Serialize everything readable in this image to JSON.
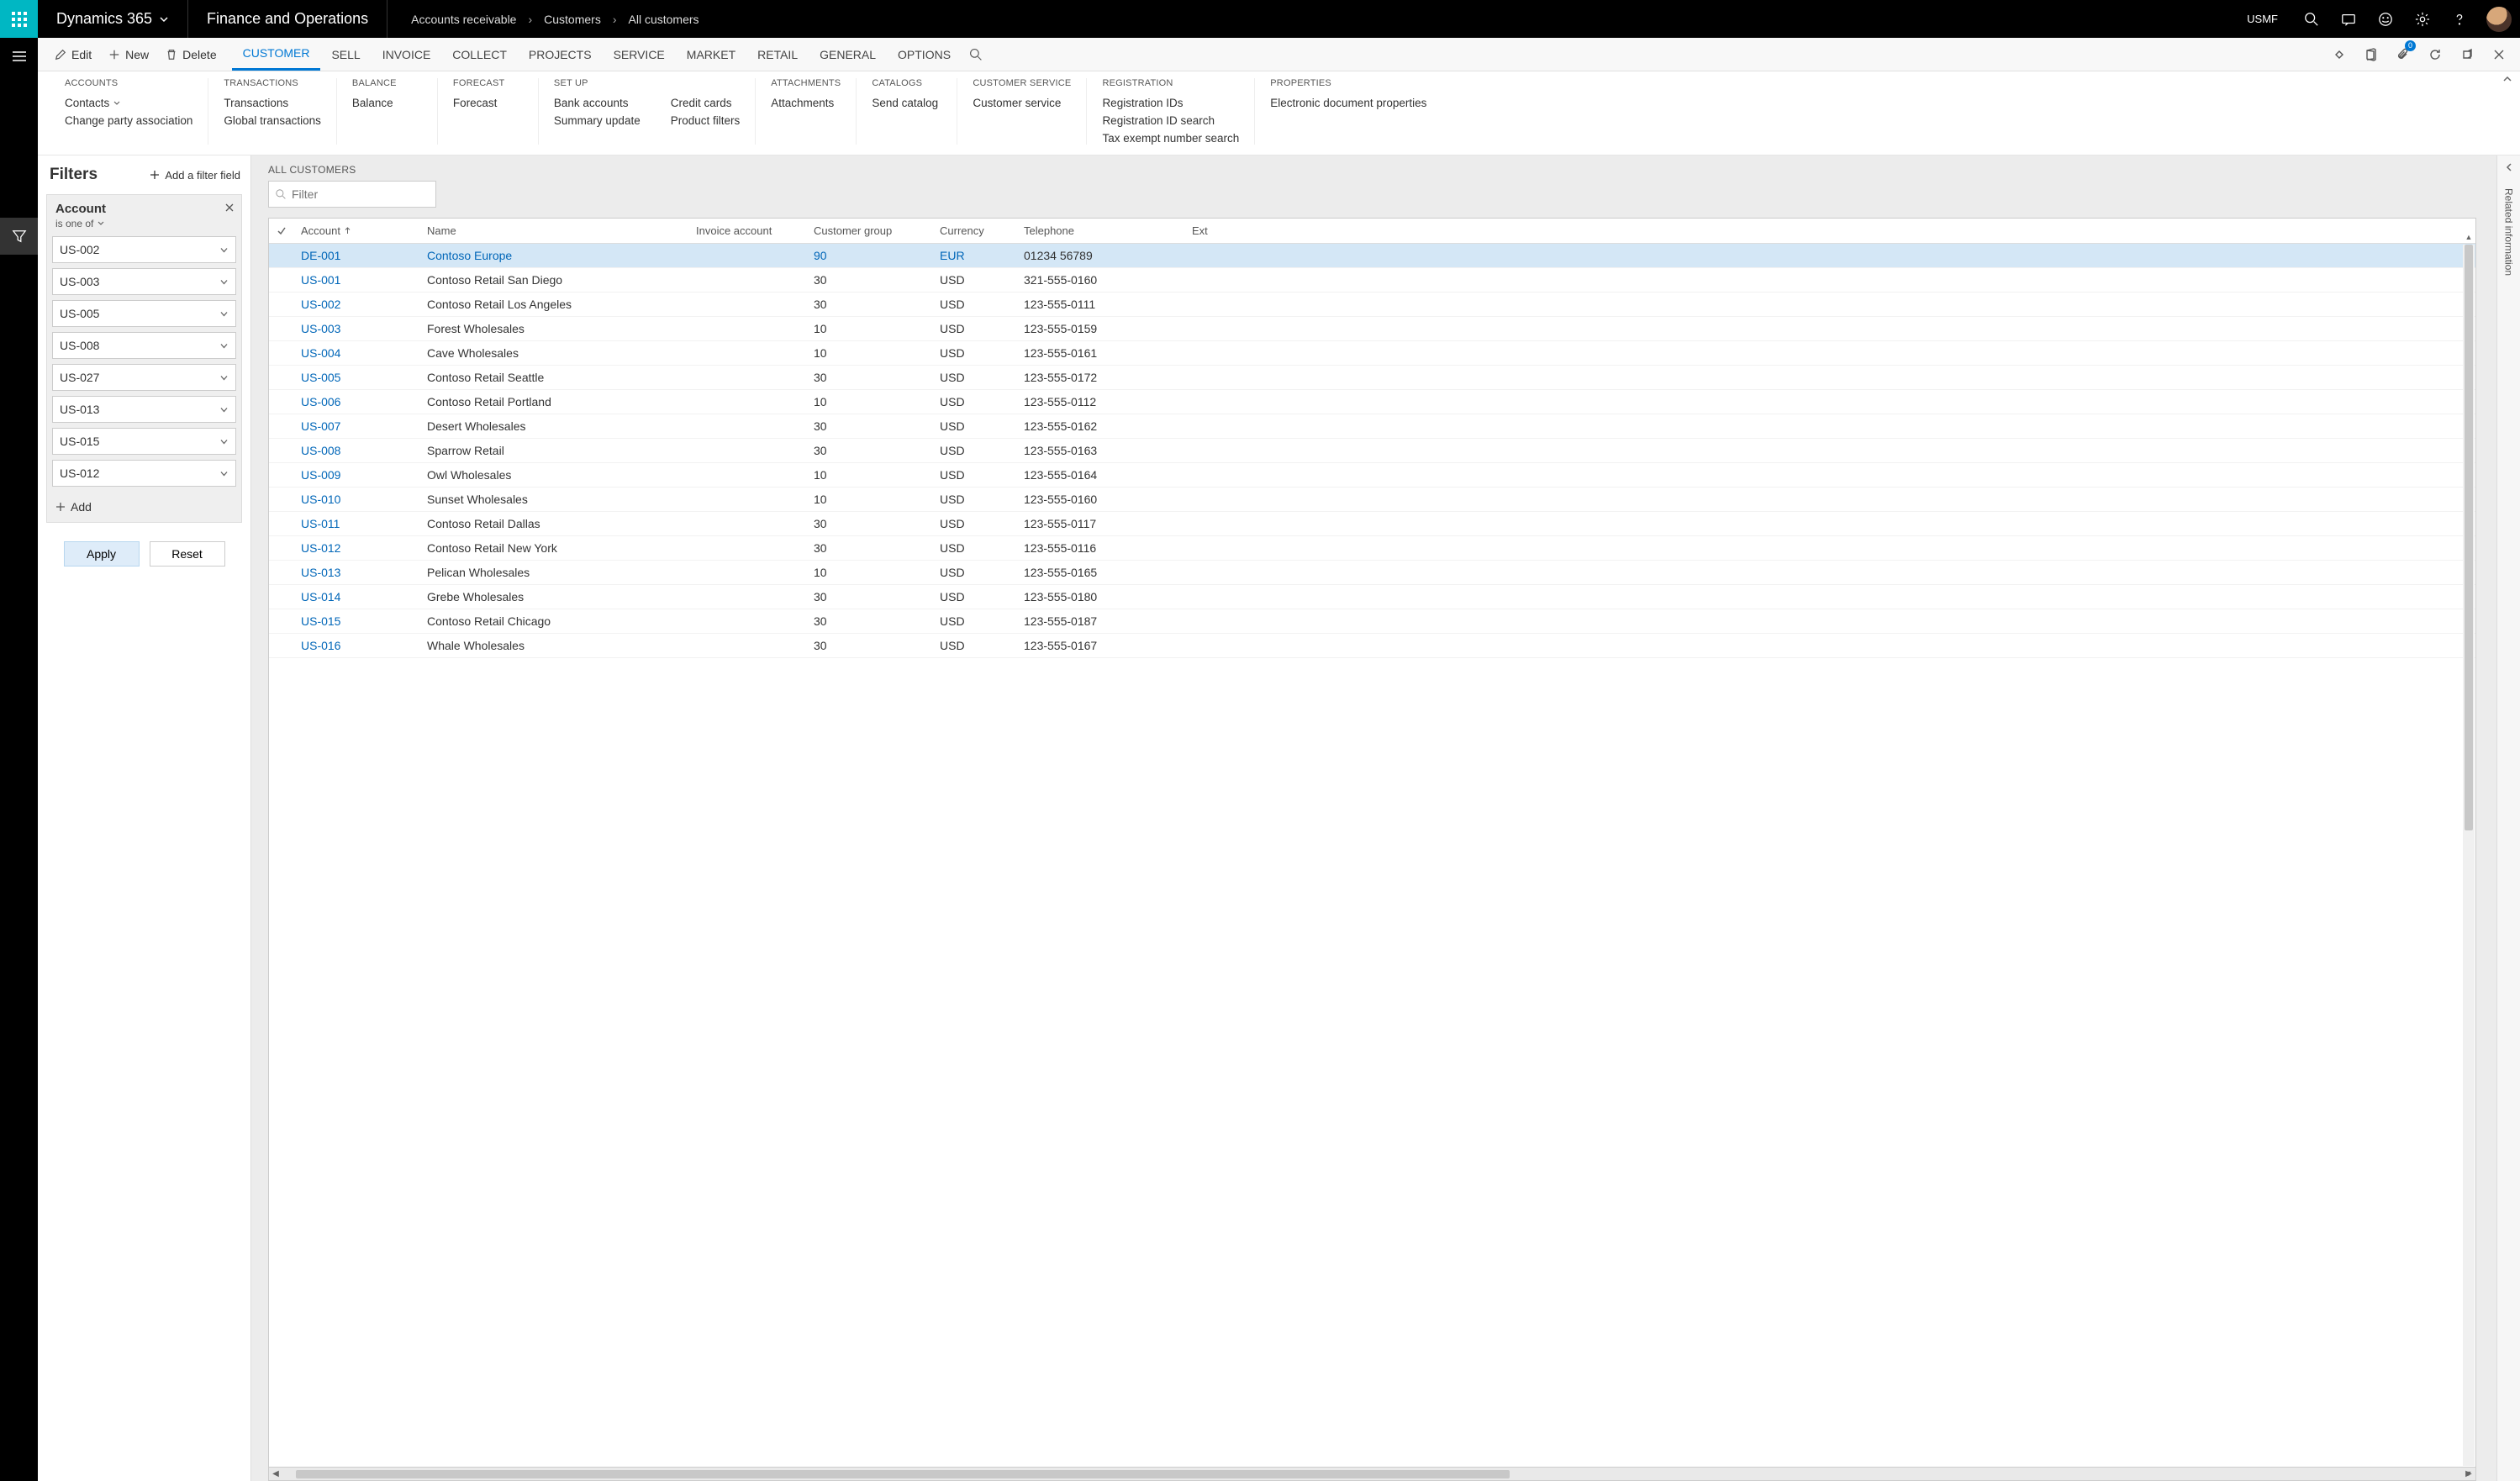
{
  "top": {
    "brand": "Dynamics 365",
    "title": "Finance and Operations",
    "breadcrumb": [
      "Accounts receivable",
      "Customers",
      "All customers"
    ],
    "entity": "USMF"
  },
  "commands": {
    "edit": "Edit",
    "new": "New",
    "delete": "Delete",
    "tabs": [
      "CUSTOMER",
      "SELL",
      "INVOICE",
      "COLLECT",
      "PROJECTS",
      "SERVICE",
      "MARKET",
      "RETAIL",
      "GENERAL",
      "OPTIONS"
    ],
    "active_tab_index": 0,
    "attach_badge": "0"
  },
  "ribbon": [
    {
      "header": "ACCOUNTS",
      "cols": [
        [
          "Contacts ▾",
          "Change party association"
        ]
      ]
    },
    {
      "header": "TRANSACTIONS",
      "cols": [
        [
          "Transactions",
          "Global transactions"
        ]
      ]
    },
    {
      "header": "BALANCE",
      "cols": [
        [
          "Balance"
        ]
      ]
    },
    {
      "header": "FORECAST",
      "cols": [
        [
          "Forecast"
        ]
      ]
    },
    {
      "header": "SET UP",
      "cols": [
        [
          "Bank accounts",
          "Summary update"
        ],
        [
          "Credit cards",
          "Product filters"
        ]
      ]
    },
    {
      "header": "ATTACHMENTS",
      "cols": [
        [
          "Attachments"
        ]
      ]
    },
    {
      "header": "CATALOGS",
      "cols": [
        [
          "Send catalog"
        ]
      ]
    },
    {
      "header": "CUSTOMER SERVICE",
      "cols": [
        [
          "Customer service"
        ]
      ]
    },
    {
      "header": "REGISTRATION",
      "cols": [
        [
          "Registration IDs",
          "Registration ID search",
          "Tax exempt number search"
        ]
      ]
    },
    {
      "header": "PROPERTIES",
      "cols": [
        [
          "Electronic document properties"
        ]
      ]
    }
  ],
  "filters": {
    "title": "Filters",
    "add_field": "Add a filter field",
    "field_name": "Account",
    "operator": "is one of",
    "values": [
      "US-002",
      "US-003",
      "US-005",
      "US-008",
      "US-027",
      "US-013",
      "US-015",
      "US-012"
    ],
    "add": "Add",
    "apply": "Apply",
    "reset": "Reset"
  },
  "grid": {
    "heading": "ALL CUSTOMERS",
    "filter_placeholder": "Filter",
    "columns": [
      "",
      "Account",
      "Name",
      "Invoice account",
      "Customer group",
      "Currency",
      "Telephone",
      "Ext"
    ],
    "sort_col": "Account",
    "rows": [
      {
        "acct": "DE-001",
        "name": "Contoso Europe",
        "inv": "",
        "grp": "90",
        "cur": "EUR",
        "tel": "01234 56789",
        "selected": true
      },
      {
        "acct": "US-001",
        "name": "Contoso Retail San Diego",
        "inv": "",
        "grp": "30",
        "cur": "USD",
        "tel": "321-555-0160"
      },
      {
        "acct": "US-002",
        "name": "Contoso Retail Los Angeles",
        "inv": "",
        "grp": "30",
        "cur": "USD",
        "tel": "123-555-0111"
      },
      {
        "acct": "US-003",
        "name": "Forest Wholesales",
        "inv": "",
        "grp": "10",
        "cur": "USD",
        "tel": "123-555-0159"
      },
      {
        "acct": "US-004",
        "name": "Cave Wholesales",
        "inv": "",
        "grp": "10",
        "cur": "USD",
        "tel": "123-555-0161"
      },
      {
        "acct": "US-005",
        "name": "Contoso Retail Seattle",
        "inv": "",
        "grp": "30",
        "cur": "USD",
        "tel": "123-555-0172"
      },
      {
        "acct": "US-006",
        "name": "Contoso Retail Portland",
        "inv": "",
        "grp": "10",
        "cur": "USD",
        "tel": "123-555-0112"
      },
      {
        "acct": "US-007",
        "name": "Desert Wholesales",
        "inv": "",
        "grp": "30",
        "cur": "USD",
        "tel": "123-555-0162"
      },
      {
        "acct": "US-008",
        "name": "Sparrow Retail",
        "inv": "",
        "grp": "30",
        "cur": "USD",
        "tel": "123-555-0163"
      },
      {
        "acct": "US-009",
        "name": "Owl Wholesales",
        "inv": "",
        "grp": "10",
        "cur": "USD",
        "tel": "123-555-0164"
      },
      {
        "acct": "US-010",
        "name": "Sunset Wholesales",
        "inv": "",
        "grp": "10",
        "cur": "USD",
        "tel": "123-555-0160"
      },
      {
        "acct": "US-011",
        "name": "Contoso Retail Dallas",
        "inv": "",
        "grp": "30",
        "cur": "USD",
        "tel": "123-555-0117"
      },
      {
        "acct": "US-012",
        "name": "Contoso Retail New York",
        "inv": "",
        "grp": "30",
        "cur": "USD",
        "tel": "123-555-0116"
      },
      {
        "acct": "US-013",
        "name": "Pelican Wholesales",
        "inv": "",
        "grp": "10",
        "cur": "USD",
        "tel": "123-555-0165"
      },
      {
        "acct": "US-014",
        "name": "Grebe Wholesales",
        "inv": "",
        "grp": "30",
        "cur": "USD",
        "tel": "123-555-0180"
      },
      {
        "acct": "US-015",
        "name": "Contoso Retail Chicago",
        "inv": "",
        "grp": "30",
        "cur": "USD",
        "tel": "123-555-0187"
      },
      {
        "acct": "US-016",
        "name": "Whale Wholesales",
        "inv": "",
        "grp": "30",
        "cur": "USD",
        "tel": "123-555-0167"
      }
    ]
  },
  "right_rail": {
    "label": "Related information"
  }
}
